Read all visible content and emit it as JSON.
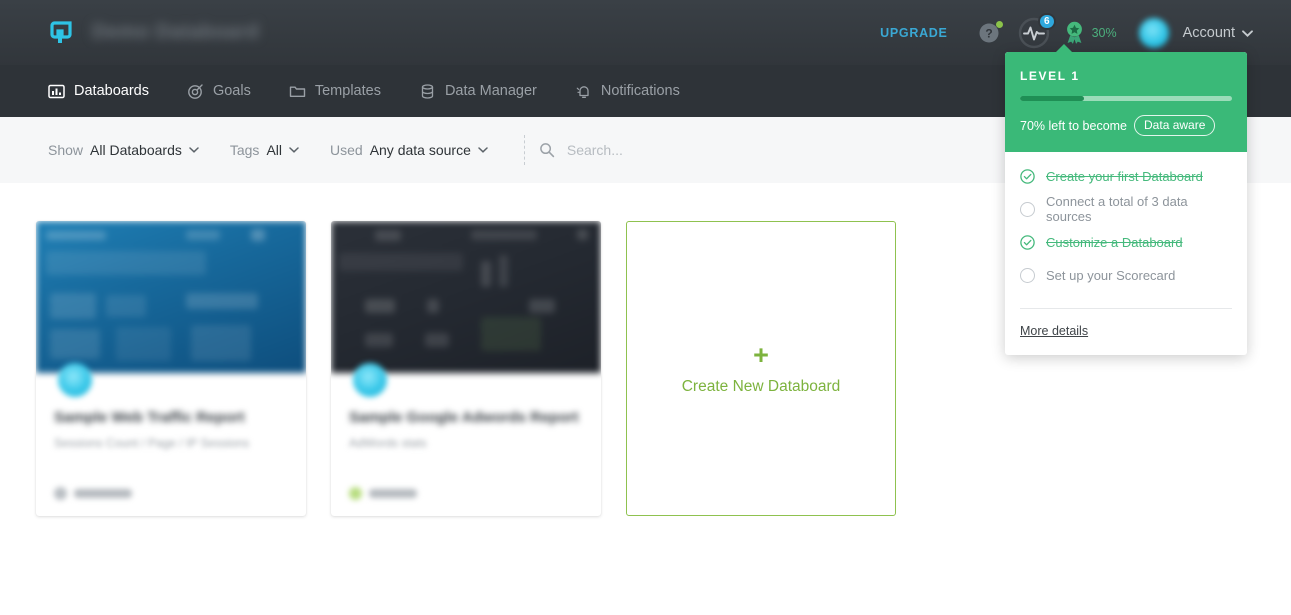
{
  "header": {
    "brand_title": "Demo Databoard",
    "logo_icon": "databox-logo-icon",
    "upgrade_label": "UPGRADE",
    "help_icon": "help-circle-icon",
    "pulse_icon": "activity-pulse-icon",
    "pulse_badge_count": "6",
    "award_icon": "award-rosette-icon",
    "award_percent": "30%",
    "avatar_icon": "user-avatar",
    "account_label": "Account",
    "account_chevron_icon": "chevron-down-icon"
  },
  "nav": {
    "items": [
      {
        "label": "Databoards",
        "icon": "chart-board-icon",
        "active": true
      },
      {
        "label": "Goals",
        "icon": "target-icon",
        "active": false
      },
      {
        "label": "Templates",
        "icon": "folder-icon",
        "active": false
      },
      {
        "label": "Data Manager",
        "icon": "database-icon",
        "active": false
      },
      {
        "label": "Notifications",
        "icon": "bell-ring-icon",
        "active": false
      }
    ]
  },
  "filters": {
    "show": {
      "label": "Show",
      "value": "All Databoards",
      "chevron_icon": "chevron-down-icon"
    },
    "tags": {
      "label": "Tags",
      "value": "All",
      "chevron_icon": "chevron-down-icon"
    },
    "used": {
      "label": "Used",
      "value": "Any data source",
      "chevron_icon": "chevron-down-icon"
    },
    "search": {
      "icon": "search-icon",
      "placeholder": "Search...",
      "value": ""
    }
  },
  "cards": [
    {
      "title": "Sample Web Traffic Report",
      "subtitle": "Sessions Count / Page / IP Sessions",
      "thumb_style": "blue",
      "badge_icon": "databoard-avatar-badge",
      "source_label": "Analytics",
      "source_dot": "gray"
    },
    {
      "title": "Sample Google Adwords Report",
      "subtitle": "AdWords stats",
      "thumb_style": "dark",
      "badge_icon": "databoard-avatar-badge",
      "source_label": "AdWords",
      "source_dot": "green"
    }
  ],
  "create_card": {
    "plus_icon": "plus-icon",
    "label": "Create New Databoard"
  },
  "popover": {
    "level_label": "LEVEL 1",
    "progress_percent": 30,
    "progress_text": "70% left to become",
    "level_chip": "Data aware",
    "checklist": [
      {
        "label": "Create your first Databoard",
        "done": true
      },
      {
        "label": "Connect a total of 3 data sources",
        "done": false
      },
      {
        "label": "Customize a Databoard",
        "done": true
      },
      {
        "label": "Set up your Scorecard",
        "done": false
      }
    ],
    "more_details_label": "More details"
  },
  "colors": {
    "header_bg": "#31363b",
    "nav_bg": "#2e3338",
    "filter_bg": "#f6f7f8",
    "accent_green": "#3ab978",
    "accent_green_dark": "#1f8f55",
    "create_green": "#7db33e",
    "upgrade_blue": "#3aa8d4",
    "badge_blue": "#2fa8dd",
    "page_bg": "#ffffff"
  }
}
